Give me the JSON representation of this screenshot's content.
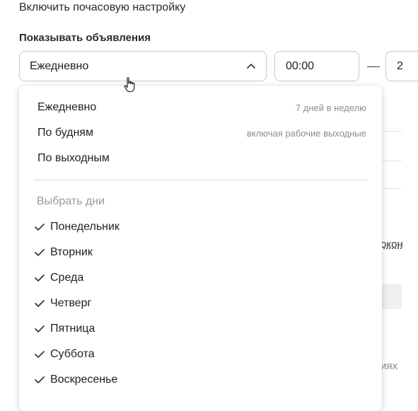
{
  "top_text": "Включить почасовую настройку",
  "section_label": "Показывать объявления",
  "select": {
    "value": "Ежедневно"
  },
  "time": {
    "from": "00:00",
    "dash": "—",
    "to": "2"
  },
  "background": {
    "right_text_1": "окон",
    "right_text_2": "иях"
  },
  "dropdown": {
    "options": [
      {
        "label": "Ежедневно",
        "hint": "7 дней в неделю"
      },
      {
        "label": "По будням",
        "hint": "включая рабочие выходные"
      },
      {
        "label": "По выходным",
        "hint": ""
      }
    ],
    "group_title": "Выбрать дни",
    "days": [
      {
        "label": "Понедельник",
        "checked": true
      },
      {
        "label": "Вторник",
        "checked": true
      },
      {
        "label": "Среда",
        "checked": true
      },
      {
        "label": "Четверг",
        "checked": true
      },
      {
        "label": "Пятница",
        "checked": true
      },
      {
        "label": "Суббота",
        "checked": true
      },
      {
        "label": "Воскресенье",
        "checked": true
      }
    ]
  },
  "icons": {
    "chevron": "chevron-up-icon",
    "check": "check-icon",
    "cursor": "hand-pointer-icon"
  }
}
